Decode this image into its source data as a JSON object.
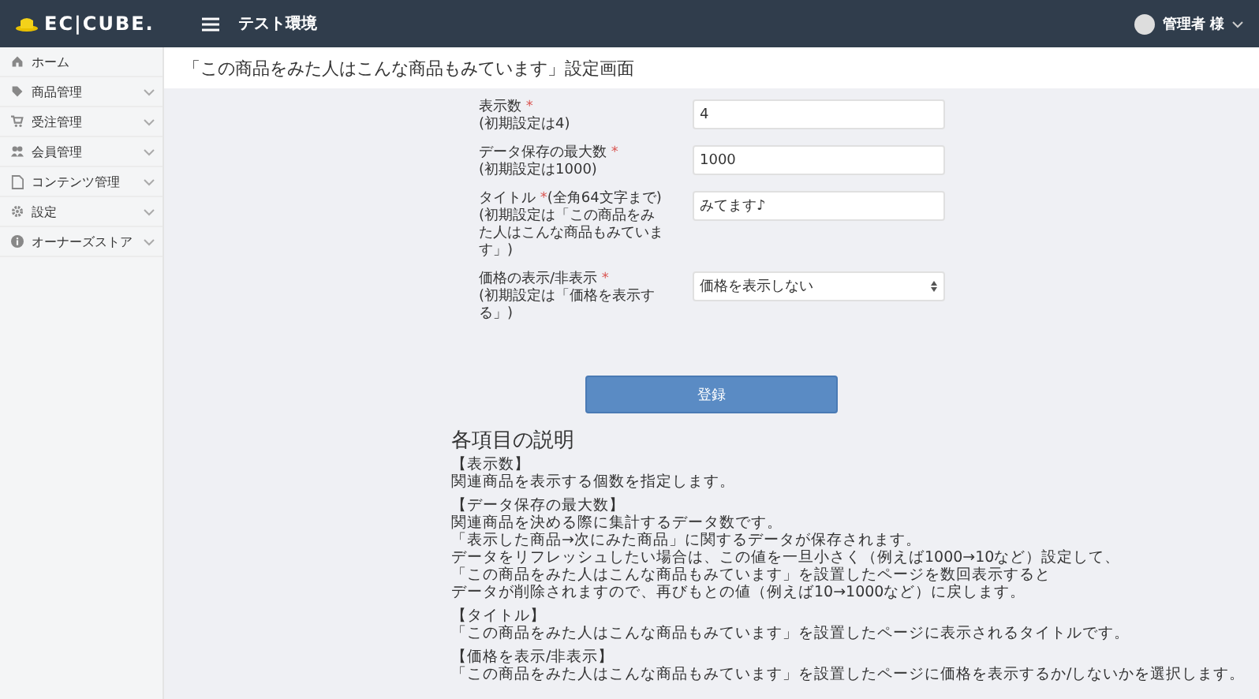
{
  "header": {
    "logo": "EC|CUBE.",
    "site_name": "テスト環境",
    "user": "管理者 様"
  },
  "sidebar": {
    "items": [
      {
        "label": "ホーム",
        "kind": "home",
        "expandable": false
      },
      {
        "label": "商品管理",
        "kind": "tag",
        "expandable": true
      },
      {
        "label": "受注管理",
        "kind": "cart",
        "expandable": true
      },
      {
        "label": "会員管理",
        "kind": "users",
        "expandable": true
      },
      {
        "label": "コンテンツ管理",
        "kind": "file",
        "expandable": true
      },
      {
        "label": "設定",
        "kind": "gear",
        "expandable": true
      },
      {
        "label": "オーナーズストア",
        "kind": "info",
        "expandable": true
      }
    ]
  },
  "page_title": "「この商品をみた人はこんな商品もみています」設定画面",
  "form": {
    "fields": [
      {
        "label": "表示数",
        "required_mark": "*",
        "note": "(初期設定は4)",
        "kind": "text",
        "value": "4"
      },
      {
        "label": "データ保存の最大数",
        "required_mark": "*",
        "note": "(初期設定は1000)",
        "kind": "text",
        "value": "1000"
      },
      {
        "label": "タイトル",
        "required_mark": "*",
        "suffix": "(全角64文字まで)",
        "note": "(初期設定は「この商品をみた人はこんな商品もみています」)",
        "kind": "text",
        "value": "みてます♪"
      },
      {
        "label": "価格の表示/非表示",
        "required_mark": "*",
        "note": "(初期設定は「価格を表示する」)",
        "kind": "select",
        "value": "価格を表示しない"
      }
    ],
    "submit": "登録"
  },
  "help": {
    "title": "各項目の説明",
    "sections": [
      {
        "heading": "【表示数】",
        "lines": [
          "関連商品を表示する個数を指定します。"
        ]
      },
      {
        "heading": "【データ保存の最大数】",
        "lines": [
          "関連商品を決める際に集計するデータ数です。",
          "「表示した商品→次にみた商品」に関するデータが保存されます。",
          "データをリフレッシュしたい場合は、この値を一旦小さく（例えば1000→10など）設定して、",
          "「この商品をみた人はこんな商品もみています」を設置したページを数回表示すると",
          "データが削除されますので、再びもとの値（例えば10→1000など）に戻します。"
        ]
      },
      {
        "heading": "【タイトル】",
        "lines": [
          "「この商品をみた人はこんな商品もみています」を設置したページに表示されるタイトルです。"
        ]
      },
      {
        "heading": "【価格を表示/非表示】",
        "lines": [
          "「この商品をみた人はこんな商品もみています」を設置したページに価格を表示するか/しないかを選択します。"
        ]
      }
    ]
  }
}
